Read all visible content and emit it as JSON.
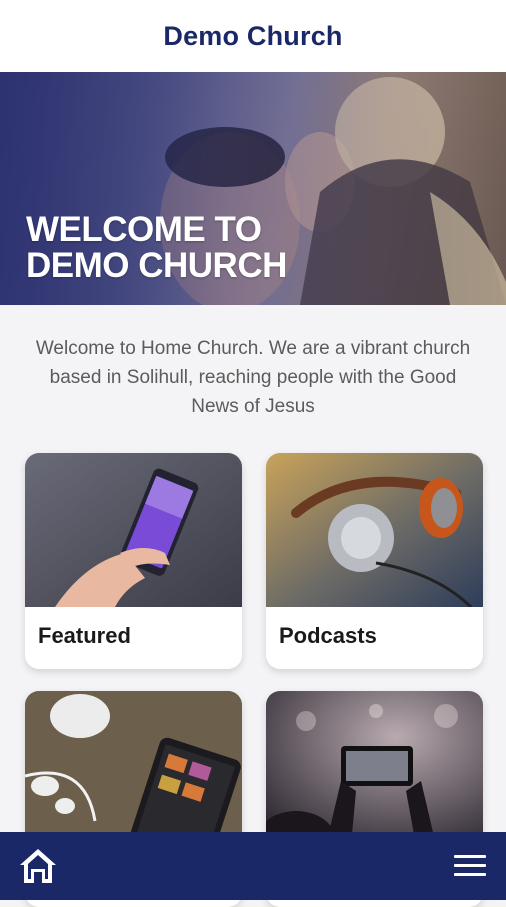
{
  "header": {
    "title": "Demo Church"
  },
  "hero": {
    "title_line1": "WELCOME TO",
    "title_line2": "DEMO CHURCH"
  },
  "intro": {
    "text": "Welcome to Home Church. We are a vibrant church based in Solihull, reaching people with the Good News of Jesus"
  },
  "tiles": [
    {
      "label": "Featured",
      "image": "phone-in-hand"
    },
    {
      "label": "Podcasts",
      "image": "headphones"
    },
    {
      "label": "",
      "image": "table-with-phone"
    },
    {
      "label": "",
      "image": "concert-phone"
    }
  ],
  "bottom_nav": {
    "left_icon": "home-icon",
    "right_icon": "hamburger-menu-icon"
  },
  "colors": {
    "brand": "#1b2868",
    "text": "#5b5b5b",
    "background": "#f4f4f6"
  }
}
